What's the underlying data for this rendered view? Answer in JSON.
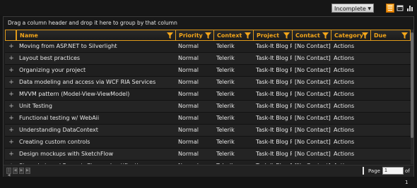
{
  "toolbar": {
    "status_filter": "Incomplete",
    "views": [
      "list-view-icon",
      "calendar-view-icon",
      "chart-view-icon"
    ]
  },
  "grid": {
    "group_panel_text": "Drag a column header and drop it here to group by that column",
    "columns": [
      "Name",
      "Priority",
      "Context",
      "Project",
      "Contact",
      "Category",
      "Due"
    ],
    "rows": [
      [
        "Moving from ASP.NET to Silverlight",
        "Normal",
        "Telerik",
        "Task-It Blog P",
        "[No Contact]",
        "Actions",
        ""
      ],
      [
        "Layout best practices",
        "Normal",
        "Telerik",
        "Task-It Blog P",
        "[No Contact]",
        "Actions",
        ""
      ],
      [
        "Organizing your project",
        "Normal",
        "Telerik",
        "Task-It Blog P",
        "[No Contact]",
        "Actions",
        ""
      ],
      [
        "Data modeling and access via WCF RIA Services",
        "Normal",
        "Telerik",
        "Task-It Blog P",
        "[No Contact]",
        "Actions",
        ""
      ],
      [
        "MVVM pattern (Model-View-ViewModel)",
        "Normal",
        "Telerik",
        "Task-It Blog P",
        "[No Contact]",
        "Actions",
        ""
      ],
      [
        "Unit Testing",
        "Normal",
        "Telerik",
        "Task-It Blog P",
        "[No Contact]",
        "Actions",
        ""
      ],
      [
        "Functional testing w/ WebAii",
        "Normal",
        "Telerik",
        "Task-It Blog P",
        "[No Contact]",
        "Actions",
        ""
      ],
      [
        "Understanding DataContext",
        "Normal",
        "Telerik",
        "Task-It Blog P",
        "[No Contact]",
        "Actions",
        ""
      ],
      [
        "Creating custom controls",
        "Normal",
        "Telerik",
        "Task-It Blog P",
        "[No Contact]",
        "Actions",
        ""
      ],
      [
        "Design mockups with SketchFlow",
        "Normal",
        "Telerik",
        "Task-It Blog P",
        "[No Contact]",
        "Actions",
        ""
      ],
      [
        "Strongly-typed PropertyChanged notifications",
        "Normal",
        "Telerik",
        "Task-It Blog P",
        "[No Contact]",
        "Actions",
        ""
      ]
    ]
  },
  "pager": {
    "page_label": "Page",
    "page_value": "1",
    "of_label": "of 1"
  },
  "colors": {
    "accent": "#f2a51a",
    "background": "#141414"
  }
}
